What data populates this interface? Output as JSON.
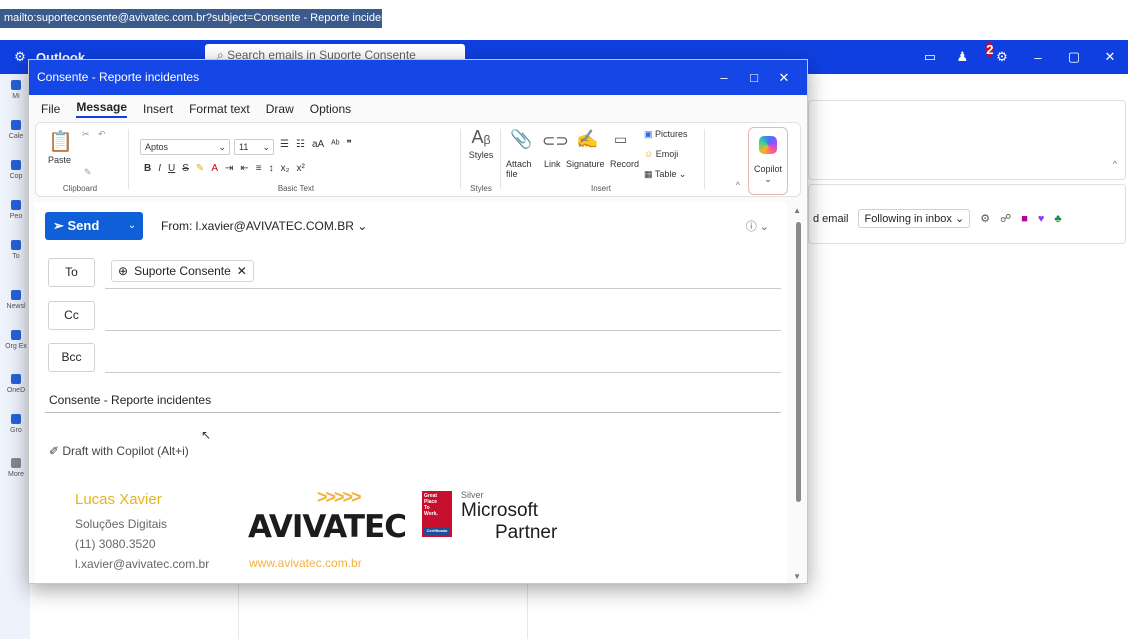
{
  "url_tooltip": "mailto:suporteconsente@avivatec.com.br?subject=Consente - Reporte inciden...",
  "outlook": {
    "app_name": "Outlook",
    "search_placeholder": "Search emails in Suporte Consente",
    "notification_count": "2"
  },
  "left_rail": [
    "Mi",
    "Cale",
    "Cop",
    "Peo",
    "To",
    "Newsl",
    "Org Ex",
    "OneD",
    "Gro",
    "More"
  ],
  "background": {
    "new_email_fragment": "d email",
    "following_label": "Following in inbox"
  },
  "compose": {
    "window_title": "Consente - Reporte incidentes",
    "menu": [
      "File",
      "Message",
      "Insert",
      "Format text",
      "Draw",
      "Options"
    ],
    "active_menu": "Message",
    "ribbon": {
      "paste": "Paste",
      "clipboard": "Clipboard",
      "font_name": "Aptos",
      "font_size": "11",
      "basic_text": "Basic Text",
      "styles": "Styles",
      "styles_group": "Styles",
      "attach": "Attach",
      "attach2": "file",
      "link": "Link",
      "signature": "Signature",
      "record": "Record",
      "pictures": "Pictures",
      "emoji": "Emoji",
      "table": "Table",
      "insert_group": "Insert",
      "copilot": "Copilot"
    },
    "send_label": "Send",
    "from_label": "From: l.xavier@AVIVATEC.COM.BR",
    "to_label": "To",
    "cc_label": "Cc",
    "bcc_label": "Bcc",
    "recipient": "Suporte Consente",
    "subject": "Consente - Reporte incidentes",
    "copilot_draft": "Draft with Copilot (Alt+i)"
  },
  "signature": {
    "name": "Lucas Xavier",
    "title": "Soluções Digitais",
    "phone": "(11) 3080.3520",
    "email": "l.xavier@avivatec.com.br",
    "company": "AVIVATEC",
    "website": "www.avivatec.com.br",
    "arrows": ">>>>>",
    "gptw": [
      "Great",
      "Place",
      "To",
      "Work."
    ],
    "gptw_cert": "Certificado",
    "ms_level": "Silver",
    "ms_name": "Microsoft",
    "ms_partner": "Partner"
  }
}
